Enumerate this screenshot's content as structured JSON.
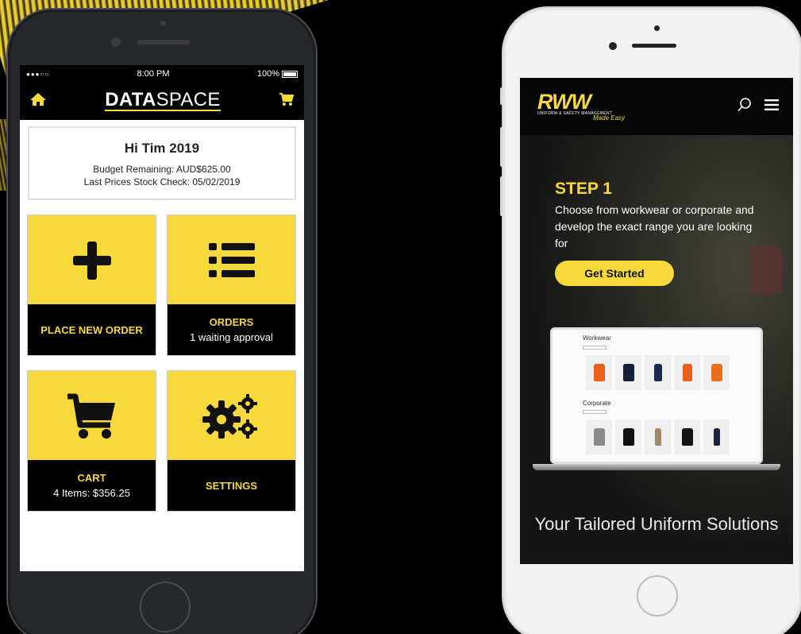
{
  "left_phone": {
    "status": {
      "carrier": "●●●○○",
      "time": "8:00 PM",
      "battery": "100%"
    },
    "appbar": {
      "logo_bold": "DATA",
      "logo_light": "SPACE",
      "home_icon": "home-icon",
      "cart_icon": "cart-icon"
    },
    "welcome": {
      "greeting": "Hi Tim 2019",
      "budget": "Budget Remaining: AUD$625.00",
      "stock_check": "Last Prices Stock Check: 05/02/2019"
    },
    "tiles": [
      {
        "title": "PLACE NEW ORDER",
        "subtitle": "",
        "icon": "plus-icon"
      },
      {
        "title": "ORDERS",
        "subtitle": "1 waiting approval",
        "icon": "list-icon"
      },
      {
        "title": "CART",
        "subtitle": "4 Items: $356.25",
        "icon": "cart-icon"
      },
      {
        "title": "SETTINGS",
        "subtitle": "",
        "icon": "gears-icon"
      }
    ],
    "colors": {
      "accent": "#f7d93b",
      "bar": "#000000"
    }
  },
  "right_phone": {
    "header": {
      "brand": "RWW",
      "brand_sub": "UNIFORM & SAFETY MANAGEMENT",
      "brand_tag": "Made Easy",
      "search_icon": "search-icon",
      "menu_icon": "hamburger-icon"
    },
    "hero": {
      "step": "STEP 1",
      "description": "Choose from workwear or corporate and develop the exact range you are looking for",
      "cta": "Get Started"
    },
    "laptop": {
      "section1": "Workwear",
      "section2": "Corporate"
    },
    "tagline": "Your Tailored Uniform Solutions",
    "colors": {
      "accent": "#f7d93b"
    }
  }
}
